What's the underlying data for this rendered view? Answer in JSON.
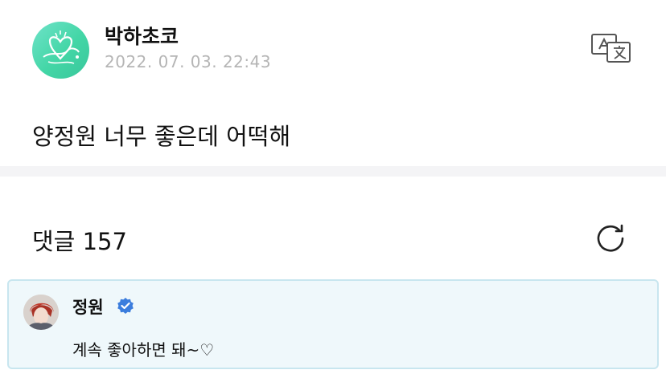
{
  "post": {
    "author": "박하초코",
    "date": "2022. 07. 03. 22:43",
    "body": "양정원 너무 좋은데 어떡해"
  },
  "comments": {
    "label": "댓글",
    "count": "157",
    "items": [
      {
        "author": "정원",
        "verified": true,
        "text": "계속 좋아하면 돼~♡"
      }
    ]
  },
  "icons": {
    "translate": "translate-icon",
    "refresh": "refresh-icon",
    "verified": "verified-badge-icon"
  },
  "colors": {
    "avatar_bg": "#43d6a6",
    "date_text": "#b5b5b5",
    "divider": "#f4f4f6",
    "comment_bg": "#eff8fb",
    "comment_border": "#c8e6ef",
    "verified_blue": "#3b7ddd"
  }
}
